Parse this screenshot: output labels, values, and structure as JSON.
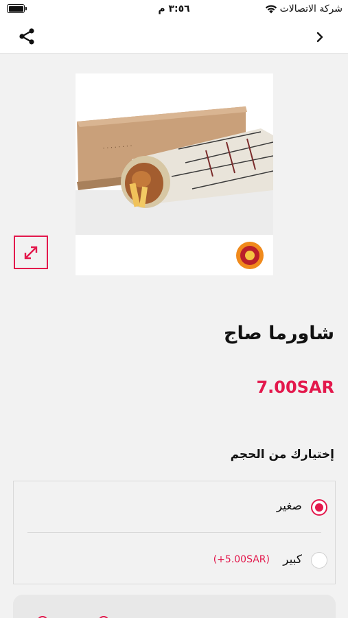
{
  "status_bar": {
    "time": "٣:٥٦ م",
    "carrier": "شركة الاتصالات",
    "battery_level": 1.0
  },
  "nav": {
    "share_icon": "share-icon",
    "back_icon": "chevron-right-icon"
  },
  "product": {
    "name": "شاورما صاج",
    "price": "7.00SAR",
    "expand_icon": "expand-arrows-icon"
  },
  "options": {
    "title": "إختيارك من الحجم",
    "items": [
      {
        "label": "صغير",
        "extra": "",
        "selected": true
      },
      {
        "label": "كبير",
        "extra": "(+5.00SAR)",
        "selected": false
      }
    ]
  },
  "colors": {
    "accent": "#e3184c",
    "background": "#f2f2f2"
  }
}
